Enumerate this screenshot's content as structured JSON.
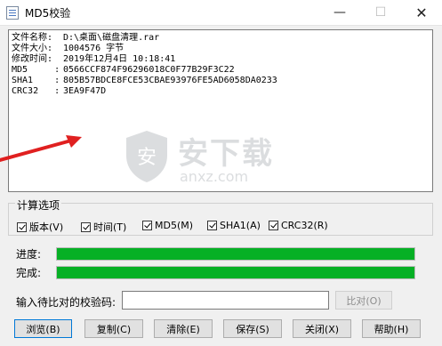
{
  "window": {
    "title": "MD5校验",
    "min_glyph": "—",
    "max_glyph": "☐",
    "close_glyph": "✕"
  },
  "output": {
    "lines": [
      {
        "label": "文件名称:",
        "value": "D:\\桌面\\磁盘清理.rar"
      },
      {
        "label": "文件大小:",
        "value": "1004576 字节"
      },
      {
        "label": "修改时间:",
        "value": "2019年12月4日 10:18:41"
      },
      {
        "label": "MD5     :",
        "value": "0566CCF874F96296018C0F77B29F3C22"
      },
      {
        "label": "SHA1    :",
        "value": "805B57BDCE8FCE53CBAE93976FE5AD6058DA0233"
      },
      {
        "label": "CRC32   :",
        "value": "3EA9F47D"
      }
    ]
  },
  "watermark": {
    "text": "安下载",
    "subtext": "anxz.com",
    "shield_char": "安"
  },
  "options": {
    "title": "计算选项",
    "items": [
      {
        "label": "版本(V)",
        "checked": true
      },
      {
        "label": "时间(T)",
        "checked": true
      },
      {
        "label": "MD5(M)",
        "checked": true
      },
      {
        "label": "SHA1(A)",
        "checked": true
      },
      {
        "label": "CRC32(R)",
        "checked": true
      }
    ]
  },
  "progress": {
    "label": "进度:",
    "fraction": 1.0,
    "color": "#06b025"
  },
  "complete": {
    "label": "完成:",
    "fraction": 1.0,
    "color": "#06b025"
  },
  "compare": {
    "label": "输入待比对的校验码:",
    "value": "",
    "button": "比对(O)"
  },
  "buttons": {
    "browse": "浏览(B)",
    "copy": "复制(C)",
    "clear": "清除(E)",
    "save": "保存(S)",
    "close": "关闭(X)",
    "help": "帮助(H)"
  },
  "colors": {
    "progress_green": "#06b025",
    "arrow_red": "#e02020"
  }
}
